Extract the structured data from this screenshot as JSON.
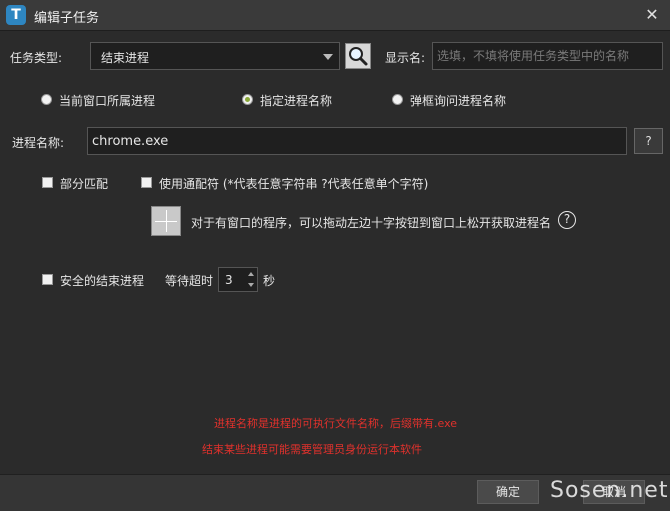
{
  "window": {
    "title": "编辑子任务",
    "app_icon_letter": "T",
    "close_symbol": "✕"
  },
  "task_type": {
    "label": "任务类型:",
    "selected": "结束进程"
  },
  "display_name": {
    "label": "显示名:",
    "placeholder": "选填，不填将使用任务类型中的名称",
    "value": ""
  },
  "process_mode": {
    "options": [
      {
        "label": "当前窗口所属进程",
        "selected": false
      },
      {
        "label": "指定进程名称",
        "selected": true
      },
      {
        "label": "弹框询问进程名称",
        "selected": false
      }
    ]
  },
  "process_name": {
    "label": "进程名称:",
    "value": "chrome.exe",
    "help_label": "?"
  },
  "options": {
    "partial_match": {
      "label": "部分匹配",
      "checked": false
    },
    "wildcard": {
      "label": "使用通配符 (*代表任意字符串 ?代表任意单个字符)",
      "checked": false
    }
  },
  "drag_hint": {
    "text": "对于有窗口的程序，可以拖动左边十字按钮到窗口上松开获取进程名",
    "help_symbol": "?"
  },
  "safe_kill": {
    "label": "安全的结束进程",
    "checked": false,
    "timeout_label": "等待超时",
    "timeout_value": "3",
    "unit": "秒"
  },
  "notes": {
    "line1": "进程名称是进程的可执行文件名称，后缀带有.exe",
    "line2": "结束某些进程可能需要管理员身份运行本软件"
  },
  "footer": {
    "ok": "确定",
    "cancel": "取消"
  },
  "watermark": "Sosen.net",
  "colors": {
    "background": "#2b2b2b",
    "note_red": "#e0312c",
    "radio_selected": "#8aa83a",
    "app_icon": "#2e86c1"
  }
}
